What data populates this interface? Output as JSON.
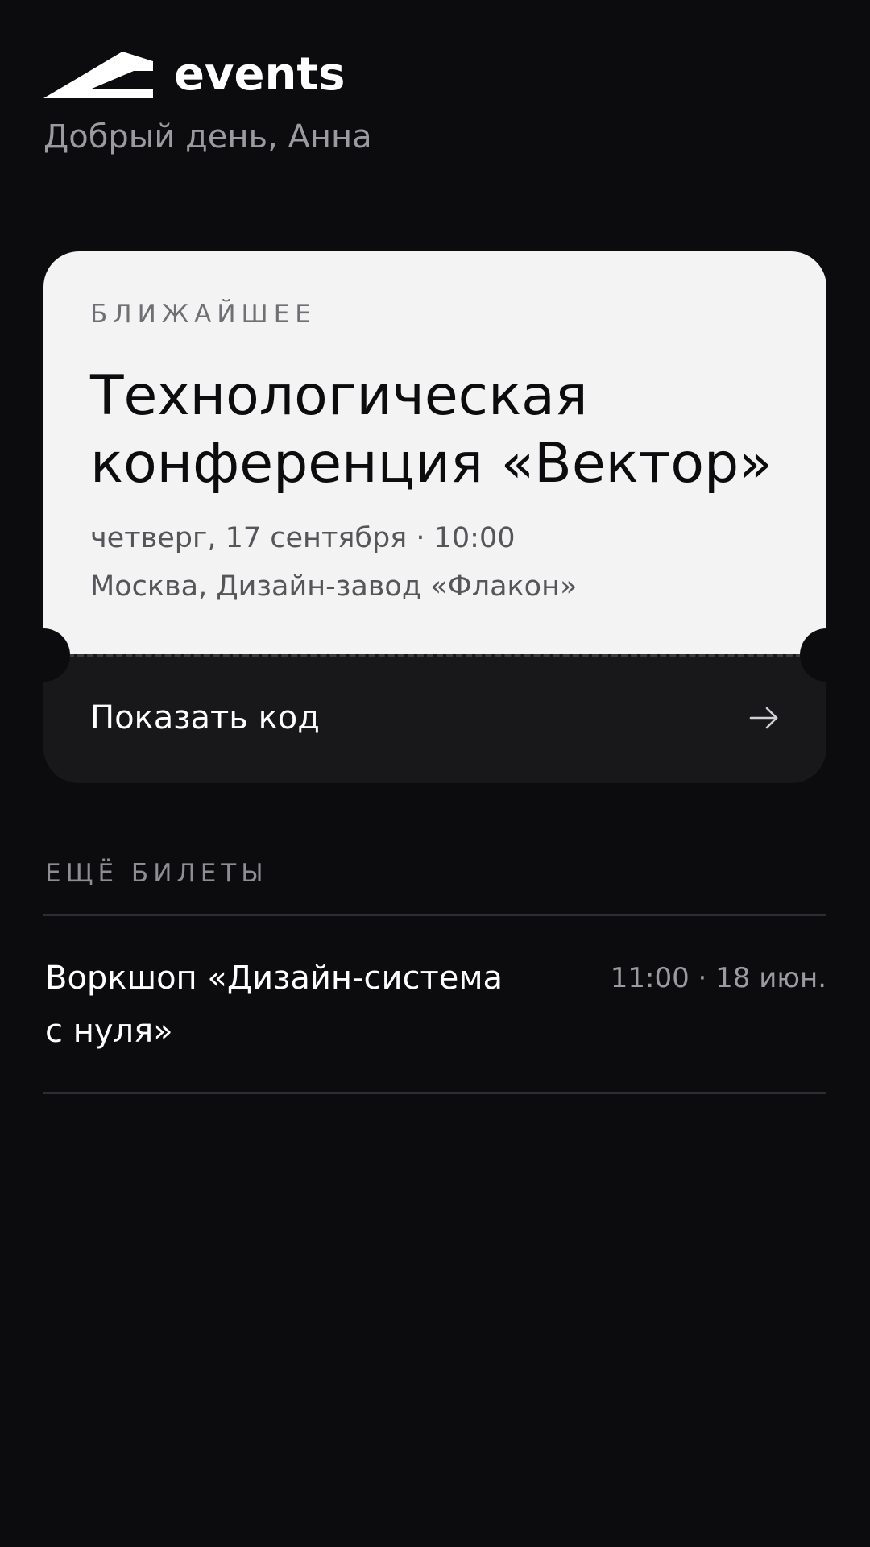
{
  "brand": {
    "name": "events",
    "logo_icon": "roof-logo-icon"
  },
  "greeting": "Добрый день, Анна",
  "upcoming": {
    "eyebrow": "БЛИЖАЙШЕЕ",
    "title": "Технологическая конференция «Вектор»",
    "datetime": "четверг, 17 сентября · 10:00",
    "location": "Москва, Дизайн-завод «Флакон»",
    "action_label": "Показать код",
    "action_icon": "arrow-right-icon"
  },
  "more_tickets": {
    "section_label": "ЕЩЁ БИЛЕТЫ",
    "items": [
      {
        "title": "Воркшоп «Дизайн-система с нуля»",
        "meta": "11:00 · 18 июн."
      }
    ]
  },
  "colors": {
    "background": "#0c0c0e",
    "card_light": "#f3f3f4",
    "card_dark": "#18181b",
    "muted_text": "#9a9a9f"
  }
}
